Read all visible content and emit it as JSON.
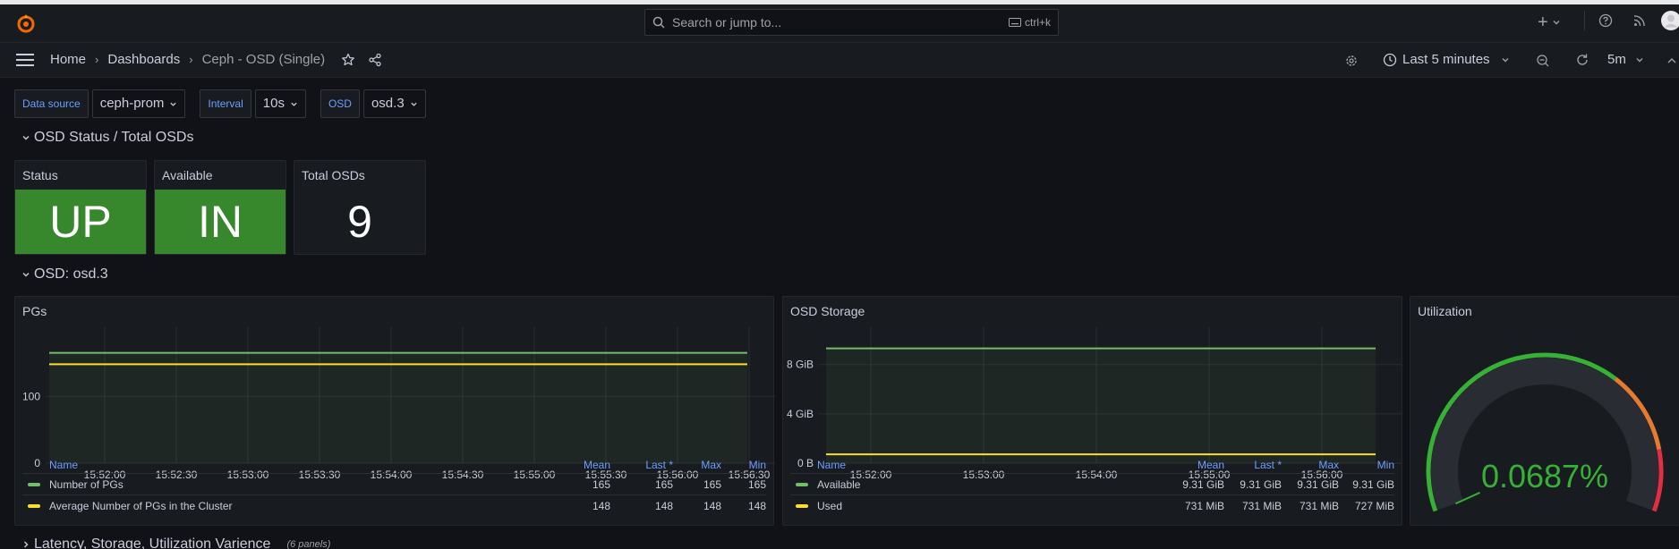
{
  "topbar": {
    "search_placeholder": "Search or jump to...",
    "search_shortcut": "ctrl+k",
    "plus_label": "+"
  },
  "nav": {
    "breadcrumbs": [
      "Home",
      "Dashboards",
      "Ceph - OSD (Single)"
    ],
    "time_range": "Last 5 minutes",
    "refresh_interval": "5m"
  },
  "variables": [
    {
      "label": "Data source",
      "value": "ceph-prom"
    },
    {
      "label": "Interval",
      "value": "10s"
    },
    {
      "label": "OSD",
      "value": "osd.3"
    }
  ],
  "rows": {
    "status_row": "OSD Status / Total OSDs",
    "osd_row": "OSD: osd.3",
    "collapsed_row": "Latency, Storage, Utilization Varience",
    "collapsed_count": "(6 panels)"
  },
  "stats": [
    {
      "title": "Status",
      "value": "UP",
      "color": "#37872d"
    },
    {
      "title": "Available",
      "value": "IN",
      "color": "#37872d"
    },
    {
      "title": "Total OSDs",
      "value": "9",
      "color": "#181b1f"
    }
  ],
  "pgs_panel": {
    "title": "PGs",
    "legend_headers": [
      "Name",
      "Mean",
      "Last *",
      "Max",
      "Min"
    ],
    "legend_rows": [
      {
        "name": "Number of PGs",
        "color": "#73bf69",
        "values": [
          "165",
          "165",
          "165",
          "165"
        ]
      },
      {
        "name": "Average Number of PGs in the Cluster",
        "color": "#fade2a",
        "values": [
          "148",
          "148",
          "148",
          "148"
        ]
      }
    ]
  },
  "storage_panel": {
    "title": "OSD Storage",
    "legend_headers": [
      "Name",
      "Mean",
      "Last *",
      "Max",
      "Min"
    ],
    "legend_rows": [
      {
        "name": "Available",
        "color": "#73bf69",
        "values": [
          "9.31 GiB",
          "9.31 GiB",
          "9.31 GiB",
          "9.31 GiB"
        ]
      },
      {
        "name": "Used",
        "color": "#fade2a",
        "values": [
          "731 MiB",
          "731 MiB",
          "731 MiB",
          "727 MiB"
        ]
      }
    ]
  },
  "utilization_panel": {
    "title": "Utilization",
    "value": "0.0687%",
    "value_color": "#37b036"
  },
  "chart_data": [
    {
      "type": "line",
      "title": "PGs",
      "x": [
        "15:52:00",
        "15:52:30",
        "15:53:00",
        "15:53:30",
        "15:54:00",
        "15:54:30",
        "15:55:00",
        "15:55:30",
        "15:56:00",
        "15:56:30"
      ],
      "series": [
        {
          "name": "Number of PGs",
          "values": [
            165,
            165,
            165,
            165,
            165,
            165,
            165,
            165,
            165,
            165
          ]
        },
        {
          "name": "Average Number of PGs in the Cluster",
          "values": [
            148,
            148,
            148,
            148,
            148,
            148,
            148,
            148,
            148,
            148
          ]
        }
      ],
      "yticks": [
        "0",
        "100"
      ],
      "ylim": [
        0,
        190
      ]
    },
    {
      "type": "line",
      "title": "OSD Storage",
      "x": [
        "15:52:00",
        "15:53:00",
        "15:54:00",
        "15:55:00",
        "15:56:00"
      ],
      "series": [
        {
          "name": "Available",
          "values": [
            9.31,
            9.31,
            9.31,
            9.31,
            9.31
          ]
        },
        {
          "name": "Used",
          "values": [
            0.714,
            0.714,
            0.714,
            0.714,
            0.714
          ]
        }
      ],
      "yticks": [
        "0 B",
        "4 GiB",
        "8 GiB"
      ],
      "ylim": [
        0,
        10.3
      ]
    },
    {
      "type": "gauge",
      "title": "Utilization",
      "value": 0.0687,
      "unit": "%",
      "range": [
        0,
        100
      ]
    }
  ]
}
